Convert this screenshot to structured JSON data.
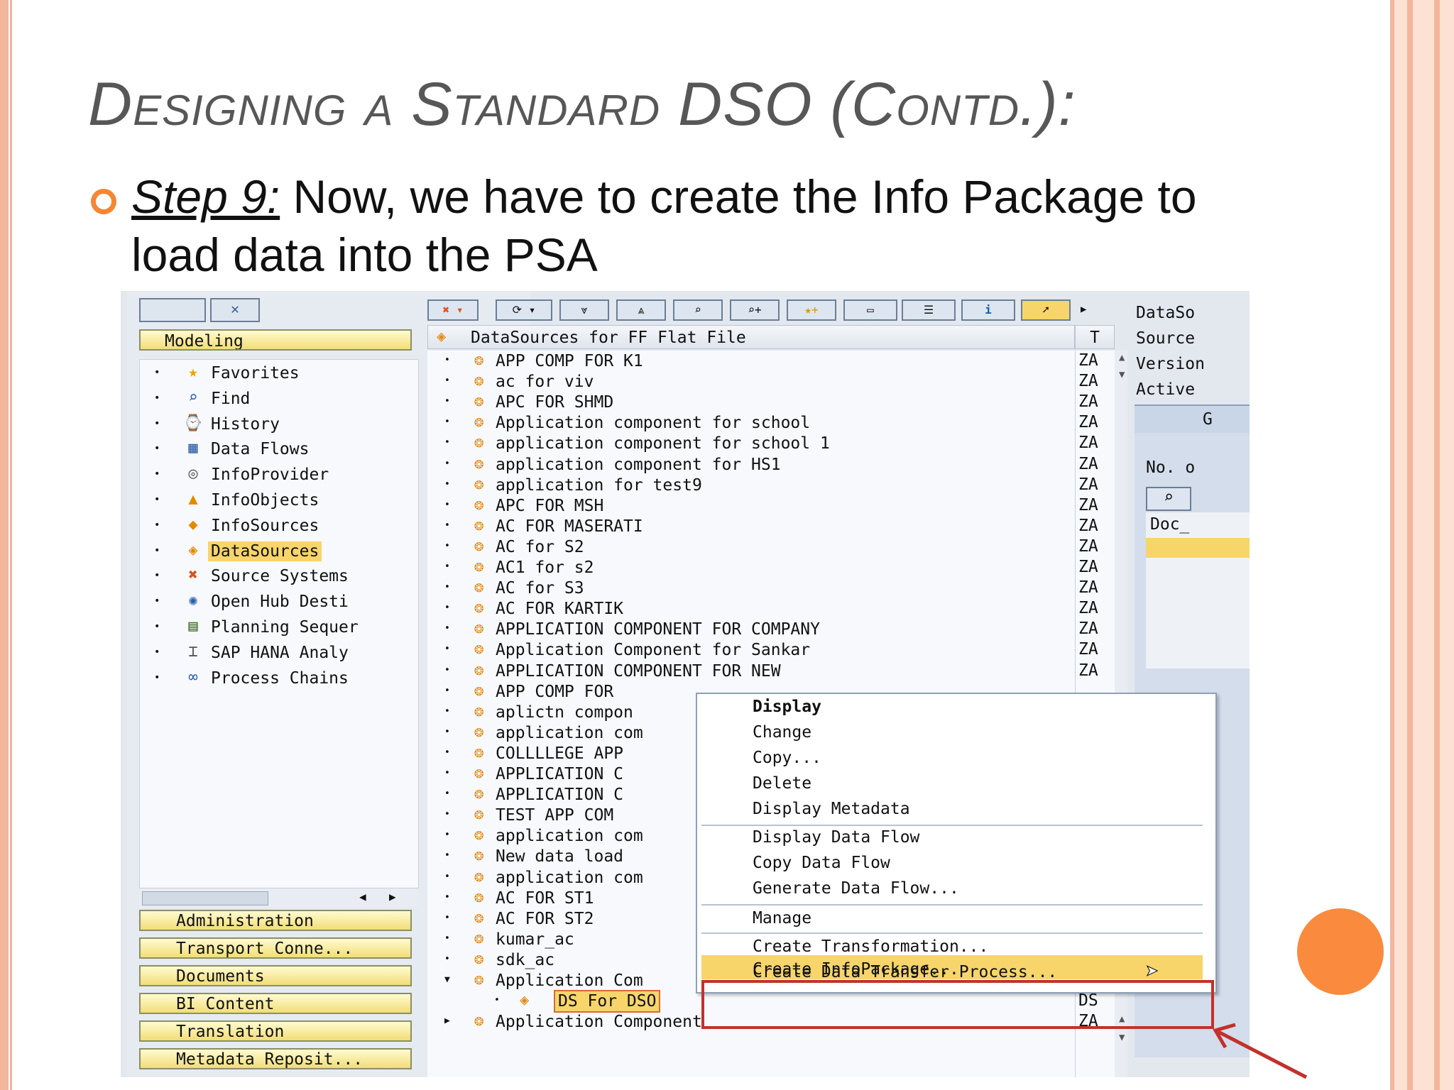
{
  "slide": {
    "title": "Designing a Standard DSO (Contd.):",
    "step_label": "Step 9:",
    "step_text": " Now, we have to create the Info Package to load data into the PSA"
  },
  "left_pane": {
    "header": "Modeling",
    "nav_items": [
      {
        "label": "Favorites",
        "icon": "star-icon"
      },
      {
        "label": "Find",
        "icon": "binoculars-icon"
      },
      {
        "label": "History",
        "icon": "history-icon"
      },
      {
        "label": "Data Flows",
        "icon": "data-flows-icon"
      },
      {
        "label": "InfoProvider",
        "icon": "infoprovider-icon"
      },
      {
        "label": "InfoObjects",
        "icon": "infoobjects-icon"
      },
      {
        "label": "InfoSources",
        "icon": "infosources-icon"
      },
      {
        "label": "DataSources",
        "icon": "datasources-icon"
      },
      {
        "label": "Source Systems",
        "icon": "source-systems-icon"
      },
      {
        "label": "Open Hub Desti",
        "icon": "open-hub-icon"
      },
      {
        "label": "Planning Sequer",
        "icon": "planning-icon"
      },
      {
        "label": "SAP HANA Analy",
        "icon": "hana-icon"
      },
      {
        "label": "Process Chains",
        "icon": "process-chains-icon"
      }
    ],
    "bottom_buttons": [
      "Administration",
      "Transport Conne...",
      "Documents",
      "BI Content",
      "Translation",
      "Metadata Reposit..."
    ]
  },
  "tree": {
    "header": "DataSources for FF Flat File",
    "col_t": "T",
    "rows": [
      {
        "label": "APP COMP FOR K1",
        "t": "ZA"
      },
      {
        "label": "ac for viv",
        "t": "ZA"
      },
      {
        "label": "APC FOR SHMD",
        "t": "ZA"
      },
      {
        "label": "Application component for school",
        "t": "ZA"
      },
      {
        "label": "application component for school 1",
        "t": "ZA"
      },
      {
        "label": "application component for HS1",
        "t": "ZA"
      },
      {
        "label": "application for test9",
        "t": "ZA"
      },
      {
        "label": "APC FOR MSH",
        "t": "ZA"
      },
      {
        "label": "AC FOR MASERATI",
        "t": "ZA"
      },
      {
        "label": "AC for S2",
        "t": "ZA"
      },
      {
        "label": "AC1 for s2",
        "t": "ZA"
      },
      {
        "label": "AC for S3",
        "t": "ZA"
      },
      {
        "label": "AC FOR KARTIK",
        "t": "ZA"
      },
      {
        "label": "APPLICATION COMPONENT FOR COMPANY",
        "t": "ZA"
      },
      {
        "label": "Application Component for Sankar",
        "t": "ZA"
      },
      {
        "label": "APPLICATION COMPONENT FOR NEW",
        "t": "ZA"
      },
      {
        "label": "APP COMP FOR",
        "t": ""
      },
      {
        "label": "aplictn compon",
        "t": ""
      },
      {
        "label": "application com",
        "t": ""
      },
      {
        "label": "COLLLLEGE APP",
        "t": ""
      },
      {
        "label": "APPLICATION C",
        "t": ""
      },
      {
        "label": "APPLICATION C",
        "t": ""
      },
      {
        "label": "TEST APP COM",
        "t": ""
      },
      {
        "label": "application com",
        "t": ""
      },
      {
        "label": "New data load",
        "t": ""
      },
      {
        "label": "application com",
        "t": ""
      },
      {
        "label": "AC FOR ST1",
        "t": ""
      },
      {
        "label": "AC FOR ST2",
        "t": ""
      },
      {
        "label": "kumar_ac",
        "t": ""
      },
      {
        "label": "sdk_ac",
        "t": ""
      },
      {
        "label": "Application Com",
        "t": ""
      },
      {
        "label": "DS For DSO",
        "t": "DS"
      },
      {
        "label": "Application Component",
        "t": "ZA"
      }
    ]
  },
  "right_pane": {
    "labels": [
      "DataSo",
      "Source",
      "Version",
      "Active"
    ],
    "tab_label": "G",
    "no_label": "No. o",
    "doc_label": "Doc_"
  },
  "context_menu": {
    "items": [
      "Display",
      "Change",
      "Copy...",
      "Delete",
      "Display Metadata",
      "Display Data Flow",
      "Copy Data Flow",
      "Generate Data Flow...",
      "Manage",
      "Create Transformation...",
      "Create Data Transfer Process...",
      "Create InfoPackage..."
    ]
  },
  "colors": {
    "accent_orange": "#f58634",
    "highlight_yellow": "#f7d56a",
    "callout_red": "#c3312a"
  }
}
